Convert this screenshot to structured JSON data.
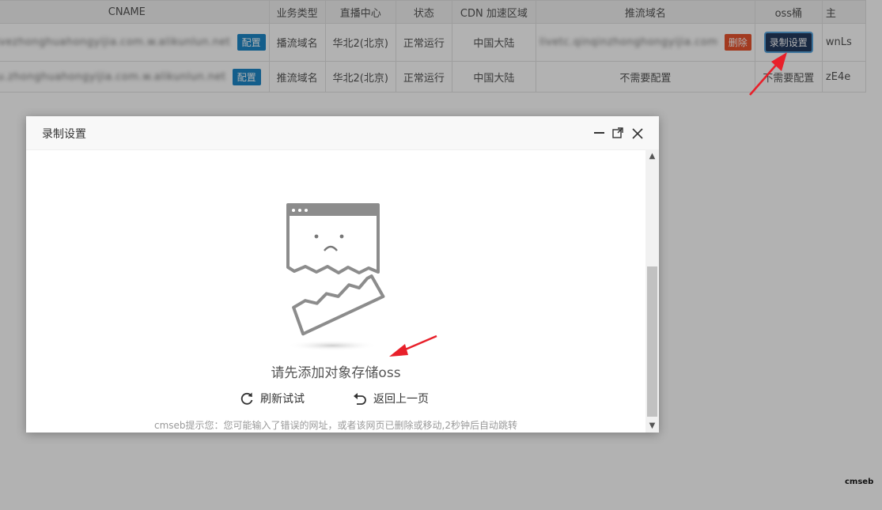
{
  "table": {
    "headers": [
      "CNAME",
      "业务类型",
      "直播中心",
      "状态",
      "CDN 加速区域",
      "推流域名",
      "oss桶",
      "主"
    ],
    "rows": [
      {
        "cname": "livezhonghuahongyijia.com.w.alikunlun.net",
        "cname_button": "配置",
        "business_type": "播流域名",
        "center": "华北2(北京)",
        "status": "正常运行",
        "region": "中国大陆",
        "push_domain": "livetc.qinqinzhonghongyijia.com",
        "push_button": "删除",
        "oss_button": "录制设置",
        "id": "wnLs"
      },
      {
        "cname": "tu.zhonghuahongyijia.com.w.alikunlun.net",
        "cname_button": "配置",
        "business_type": "推流域名",
        "center": "华北2(北京)",
        "status": "正常运行",
        "region": "中国大陆",
        "push_domain": "不需要配置",
        "oss_text": "不需要配置",
        "id": "zE4e"
      }
    ]
  },
  "modal": {
    "title": "录制设置",
    "message": "请先添加对象存储oss",
    "refresh_label": "刷新试试",
    "back_label": "返回上一页",
    "hint": "cmseb提示您：您可能输入了错误的网址，或者该网页已删除或移动,2秒钟后自动跳转"
  },
  "watermark": "cmseb",
  "colors": {
    "accent_blue": "#1e87c8",
    "danger_red": "#e8532e",
    "navy_button": "#233a5e",
    "annotation_arrow": "#e8202a"
  },
  "icons": [
    "minimize-icon",
    "maximize-icon",
    "close-icon",
    "refresh-icon",
    "back-icon",
    "broken-page-icon",
    "annotation-arrow-icon"
  ]
}
